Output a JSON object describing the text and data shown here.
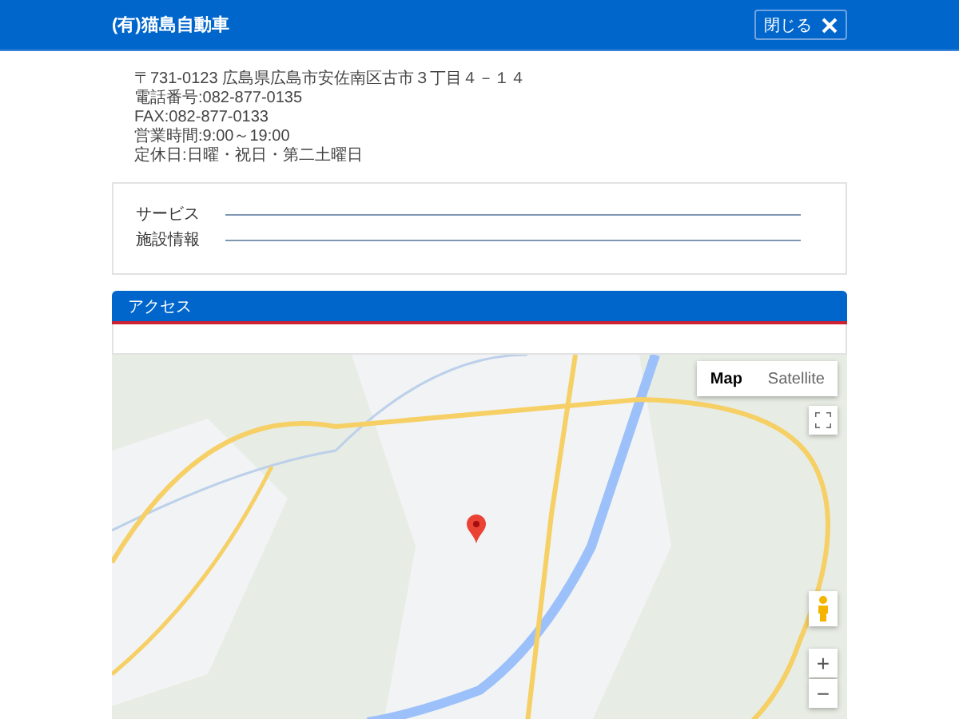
{
  "header": {
    "title": "(有)猫島自動車",
    "close_button": "閉じる"
  },
  "info": [
    "〒731-0123 広島県広島市安佐南区古市３丁目４－１４",
    "電話番号:082-877-0135",
    "FAX:082-877-0133",
    "営業時間:9:00～19:00",
    "定休日:日曜・祝日・第二土曜日"
  ],
  "details": [
    {
      "label": "サービス"
    },
    {
      "label": "施設情報"
    }
  ],
  "access": {
    "title": "アクセス"
  },
  "map": {
    "type_buttons": [
      {
        "label": "Map",
        "selected": true
      },
      {
        "label": "Satellite",
        "selected": false
      }
    ],
    "zoom_in": "+",
    "zoom_out": "−"
  }
}
